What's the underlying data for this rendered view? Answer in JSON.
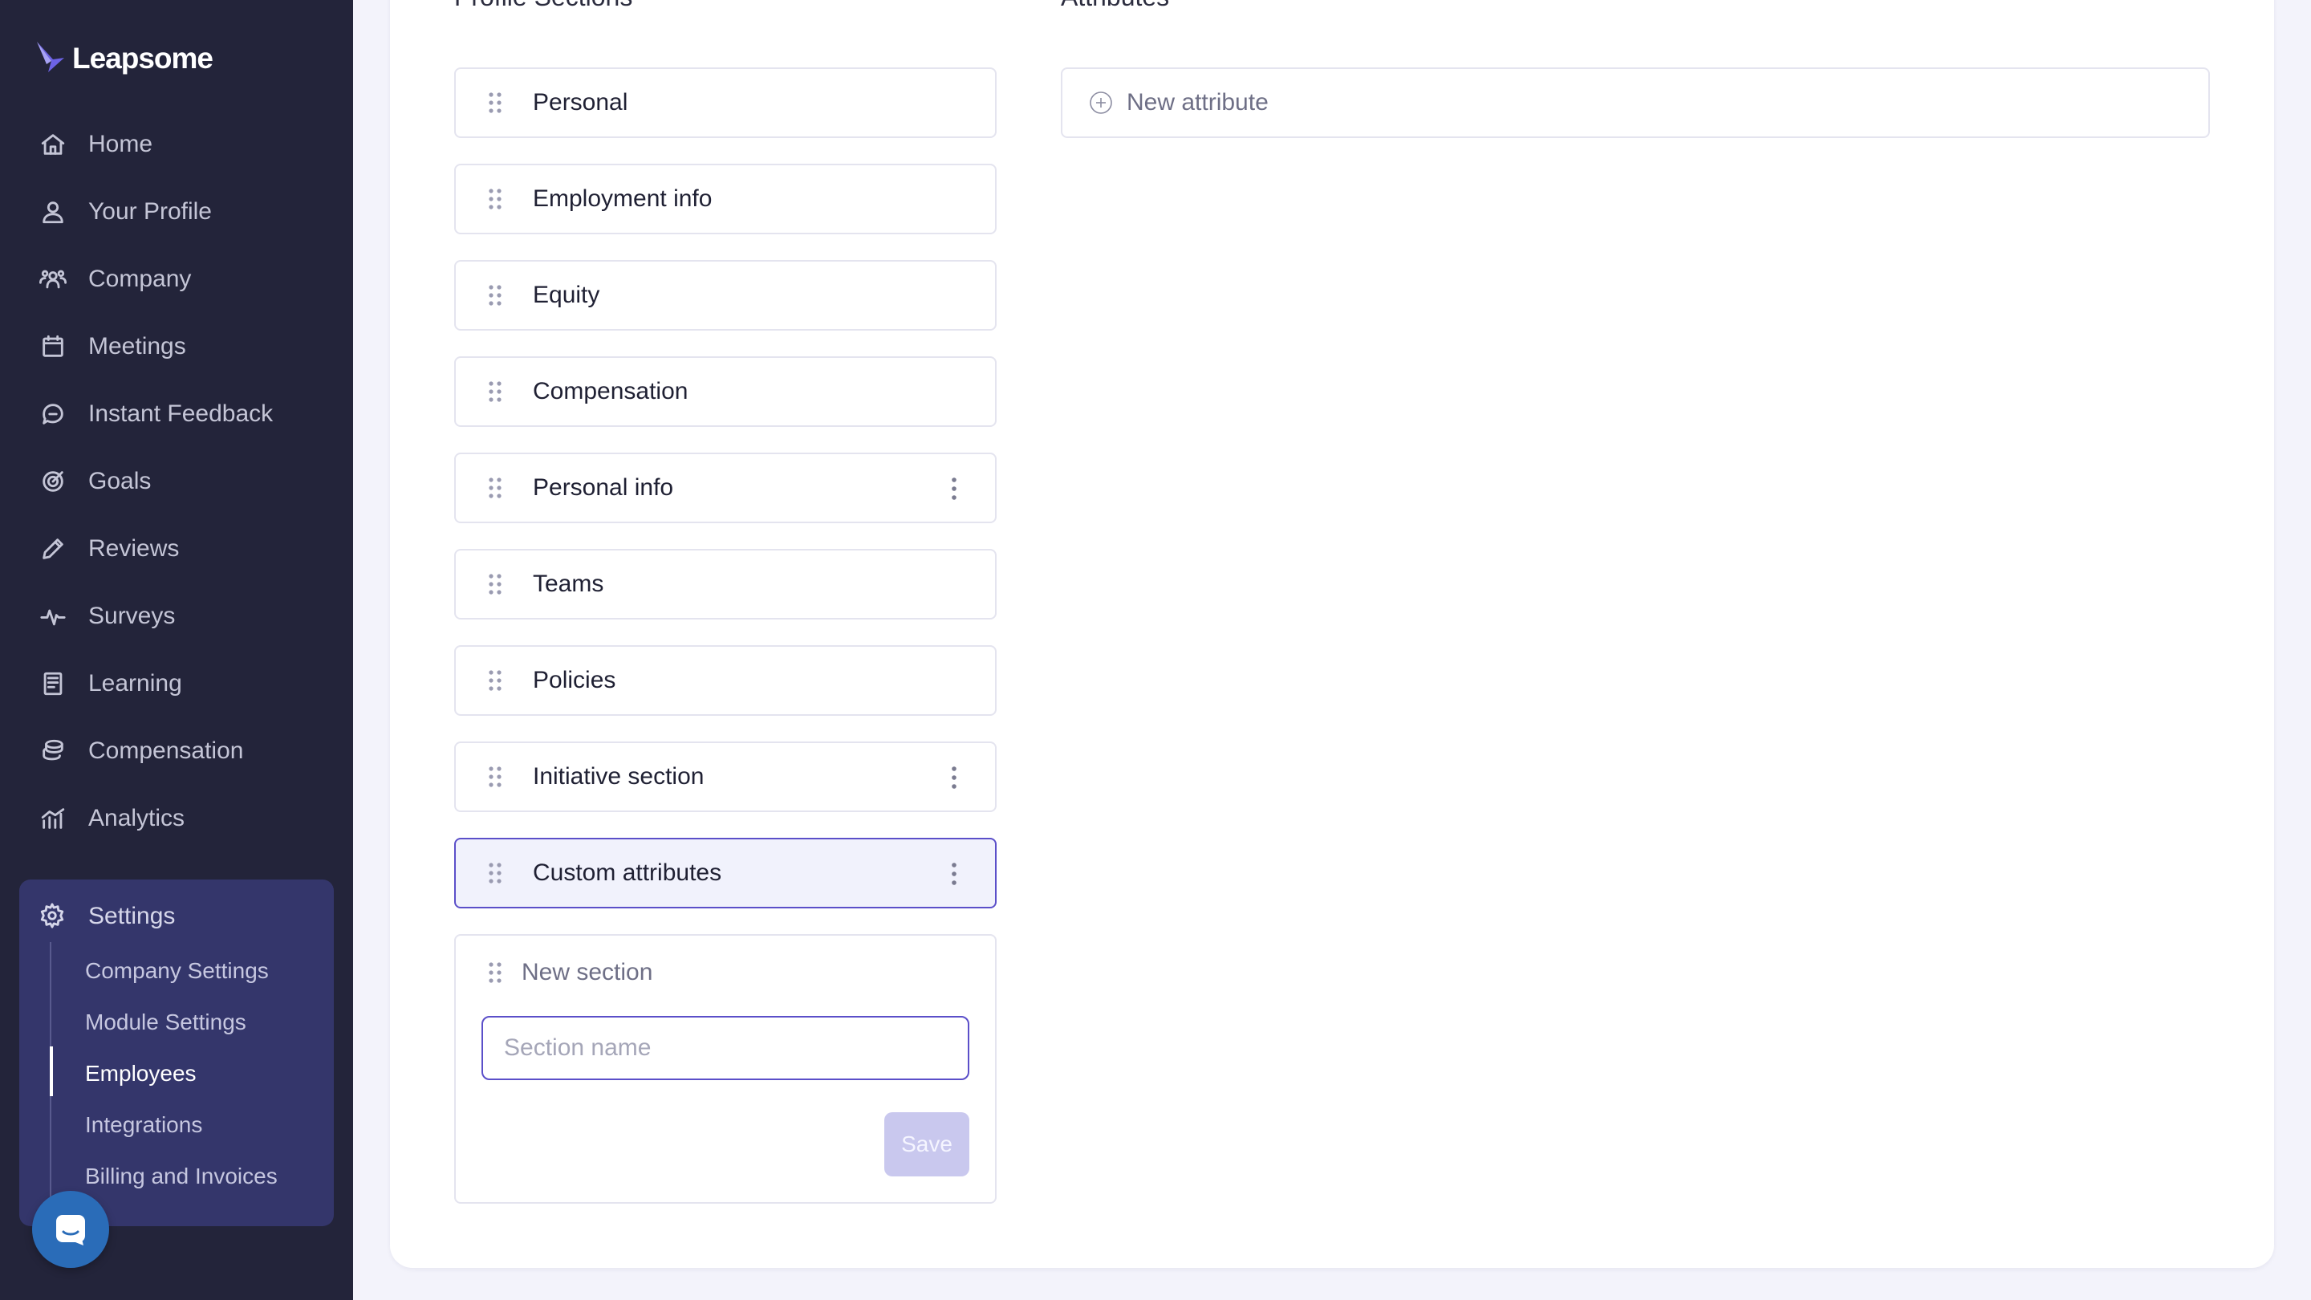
{
  "brand": {
    "name": "Leapsome"
  },
  "nav": {
    "items": [
      {
        "label": "Home",
        "icon": "home-icon"
      },
      {
        "label": "Your Profile",
        "icon": "user-icon"
      },
      {
        "label": "Company",
        "icon": "users-icon"
      },
      {
        "label": "Meetings",
        "icon": "calendar-icon"
      },
      {
        "label": "Instant Feedback",
        "icon": "chat-icon"
      },
      {
        "label": "Goals",
        "icon": "target-icon"
      },
      {
        "label": "Reviews",
        "icon": "pencil-icon"
      },
      {
        "label": "Surveys",
        "icon": "pulse-icon"
      },
      {
        "label": "Learning",
        "icon": "book-icon"
      },
      {
        "label": "Compensation",
        "icon": "coins-icon"
      },
      {
        "label": "Analytics",
        "icon": "chart-icon"
      }
    ],
    "settings": {
      "label": "Settings",
      "icon": "gear-icon",
      "sub_items": [
        {
          "label": "Company Settings"
        },
        {
          "label": "Module Settings"
        },
        {
          "label": "Employees",
          "active": true
        },
        {
          "label": "Integrations"
        },
        {
          "label": "Billing and Invoices"
        }
      ]
    }
  },
  "main": {
    "sections_title": "Profile Sections",
    "attributes_title": "Attributes",
    "sections": [
      {
        "label": "Personal",
        "has_menu": false
      },
      {
        "label": "Employment info",
        "has_menu": false
      },
      {
        "label": "Equity",
        "has_menu": false
      },
      {
        "label": "Compensation",
        "has_menu": false
      },
      {
        "label": "Personal info",
        "has_menu": true
      },
      {
        "label": "Teams",
        "has_menu": false
      },
      {
        "label": "Policies",
        "has_menu": false
      },
      {
        "label": "Initiative section",
        "has_menu": true
      },
      {
        "label": "Custom attributes",
        "has_menu": true,
        "selected": true
      }
    ],
    "new_section": {
      "title": "New section",
      "input_placeholder": "Section name",
      "input_value": "",
      "save_label": "Save"
    },
    "new_attribute_label": "New attribute"
  },
  "colors": {
    "sidebar_bg": "#23243a",
    "settings_bg": "#34366b",
    "accent": "#5b4fc9",
    "save_disabled": "#c9c8ee",
    "chat_button": "#2a6cb8"
  }
}
